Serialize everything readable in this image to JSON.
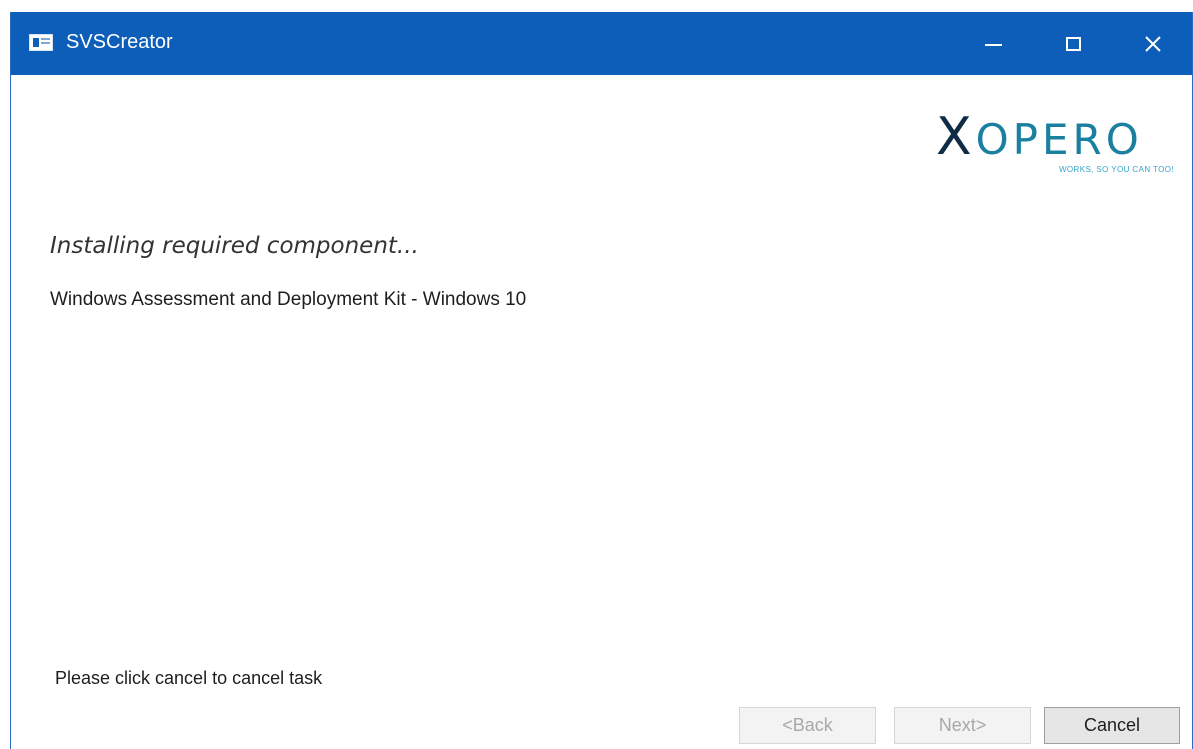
{
  "window": {
    "title": "SVSCreator",
    "controls": {
      "minimize_icon": "minimize-icon",
      "maximize_icon": "maximize-icon",
      "close_icon": "close-icon",
      "close_glyph": "✕"
    },
    "accent_color": "#0c5eb8"
  },
  "logo": {
    "x_letter": "X",
    "rest": "OPERO",
    "tagline": "WORKS, SO YOU CAN TOO!"
  },
  "content": {
    "heading": "Installing required component...",
    "component_name": "Windows Assessment and Deployment Kit - Windows 10",
    "status_message": "Please click cancel to cancel task"
  },
  "buttons": {
    "back_label": "<Back",
    "next_label": "Next>",
    "cancel_label": "Cancel",
    "back_enabled": false,
    "next_enabled": false,
    "cancel_enabled": true
  }
}
